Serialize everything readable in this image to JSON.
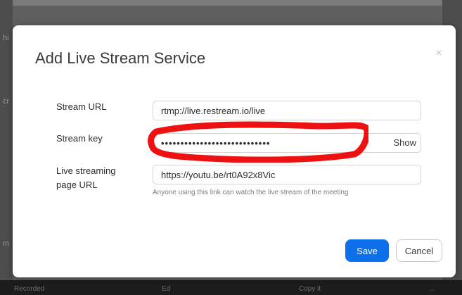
{
  "background": {
    "fragments": [
      "hi",
      "cr",
      "m"
    ],
    "bottom_text": [
      "Recorded",
      "Ed",
      "Copy it",
      "..."
    ]
  },
  "dialog": {
    "title": "Add Live Stream Service",
    "close_symbol": "×",
    "fields": {
      "stream_url": {
        "label": "Stream URL",
        "value": "rtmp://live.restream.io/live"
      },
      "stream_key": {
        "label": "Stream key",
        "value": "••••••••••••••••••••••••••••",
        "show_label": "Show",
        "redacted": true
      },
      "page_url": {
        "label_line1": "Live streaming",
        "label_line2": "page URL",
        "value": "https://youtu.be/rt0A92x8Vic",
        "hint": "Anyone using this link can watch the live stream of the meeting"
      }
    },
    "buttons": {
      "save": "Save",
      "cancel": "Cancel"
    },
    "colors": {
      "primary": "#0e71eb",
      "redaction": "#ee1111"
    }
  }
}
